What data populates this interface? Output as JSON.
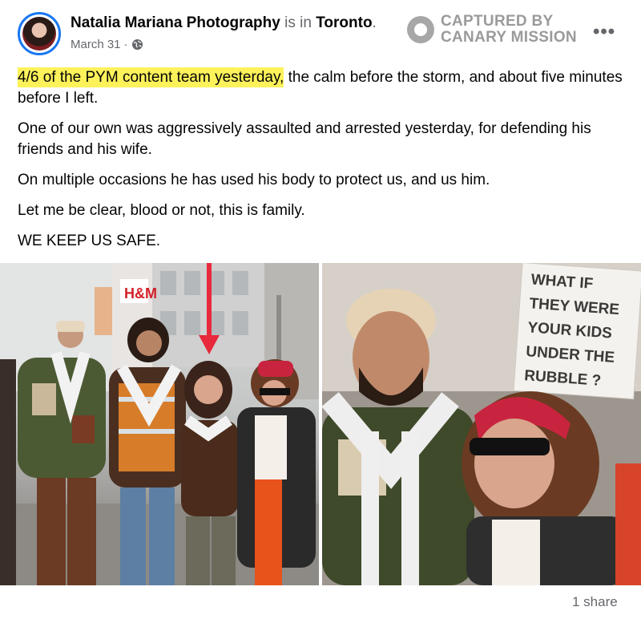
{
  "post": {
    "author": "Natalia Mariana Photography",
    "location_connector": " is in ",
    "location": "Toronto",
    "location_suffix": ".",
    "date": "March 31",
    "date_sep": " ·"
  },
  "watermark": {
    "line1": "CAPTURED BY",
    "line2": "CANARY MISSION"
  },
  "body": {
    "p1_highlight": "4/6 of the PYM content team yesterday,",
    "p1_rest": " the calm before the storm, and about five minutes before I left.",
    "p2": "One of our own was aggressively assaulted and arrested yesterday, for defending his friends and his wife.",
    "p3": "On multiple occasions he has used his body to protect us, and us him.",
    "p4": "Let me be clear, blood or not, this is family.",
    "p5": "WE KEEP US SAFE."
  },
  "photo_left": {
    "store_sign": "H&M"
  },
  "photo_right": {
    "sign_lines": [
      "WHAT IF",
      "THEY WERE",
      "YOUR KIDS",
      "UNDER THE",
      "RUBBLE ?"
    ]
  },
  "footer": {
    "shares": "1 share"
  },
  "colors": {
    "highlight": "#fdf25a",
    "arrow": "#e8293b",
    "avatar_ring": "#1877f2"
  }
}
